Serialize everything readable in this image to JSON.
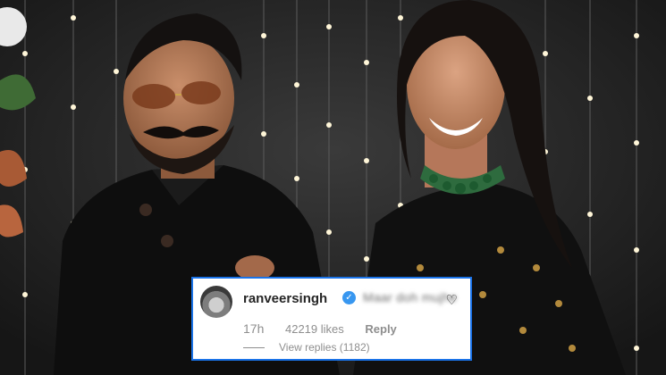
{
  "comment": {
    "username": "ranveersingh",
    "verified_icon": "verified-badge-icon",
    "text": "Maar doh mujhe",
    "time": "17h",
    "likes": "42219 likes",
    "reply_label": "Reply",
    "view_replies": "View replies (1182)",
    "like_icon": "heart-outline-icon"
  },
  "colors": {
    "card_border": "#1a73e8",
    "verified": "#3897f0"
  }
}
